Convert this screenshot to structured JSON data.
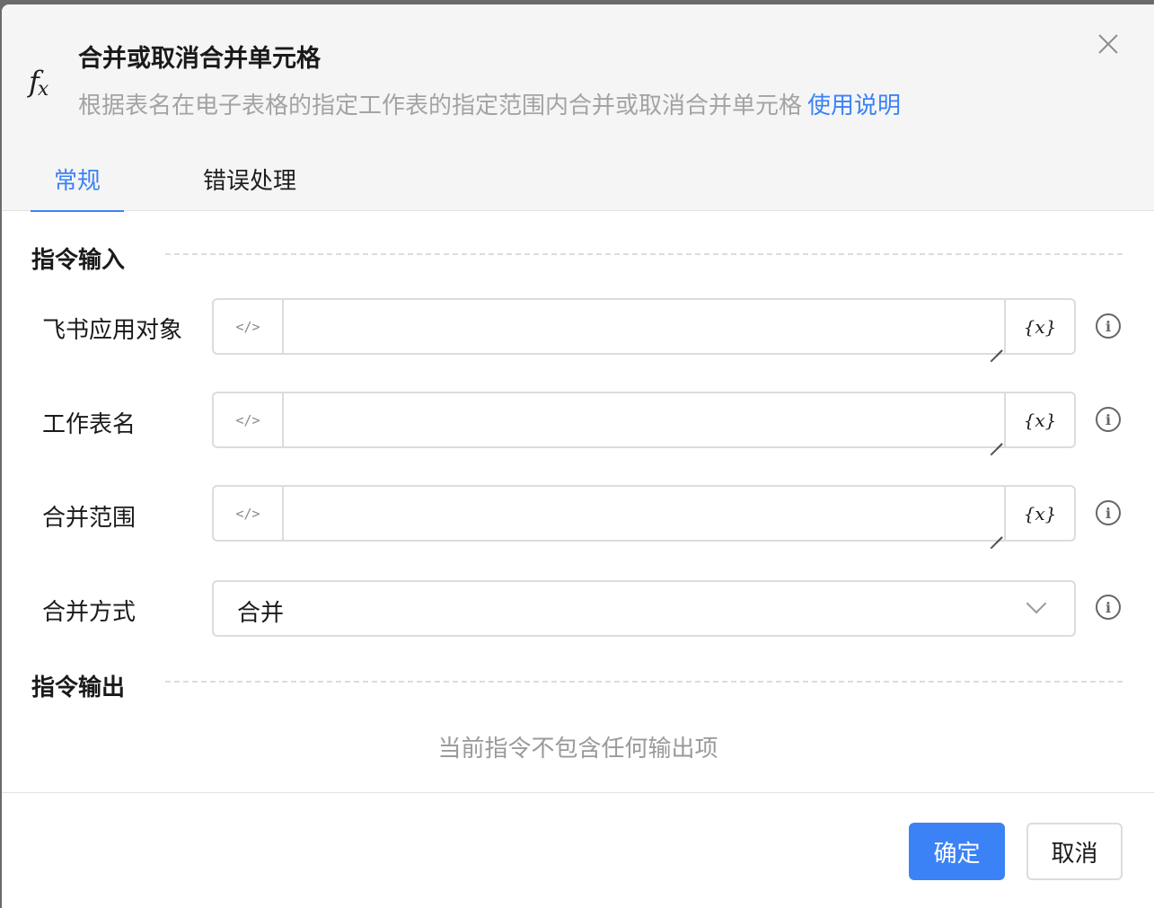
{
  "dialog": {
    "title": "合并或取消合并单元格",
    "description": "根据表名在电子表格的指定工作表的指定范围内合并或取消合并单元格",
    "help_link": "使用说明",
    "icon": "fx-icon"
  },
  "tabs": [
    {
      "label": "常规",
      "active": true
    },
    {
      "label": "错误处理",
      "active": false
    }
  ],
  "sections": {
    "input_title": "指令输入",
    "output_title": "指令输出",
    "output_empty": "当前指令不包含任何输出项"
  },
  "fields": [
    {
      "label": "飞书应用对象",
      "value": ""
    },
    {
      "label": "工作表名",
      "value": ""
    },
    {
      "label": "合并范围",
      "value": ""
    }
  ],
  "merge_mode": {
    "label": "合并方式",
    "selected": "合并"
  },
  "icons": {
    "code_toggle": "</>",
    "variable": "{x}"
  },
  "buttons": {
    "confirm": "确定",
    "cancel": "取消"
  },
  "colors": {
    "accent": "#3b82f6",
    "header_bg": "#f5f5f5",
    "muted_text": "#a3a3a3"
  }
}
